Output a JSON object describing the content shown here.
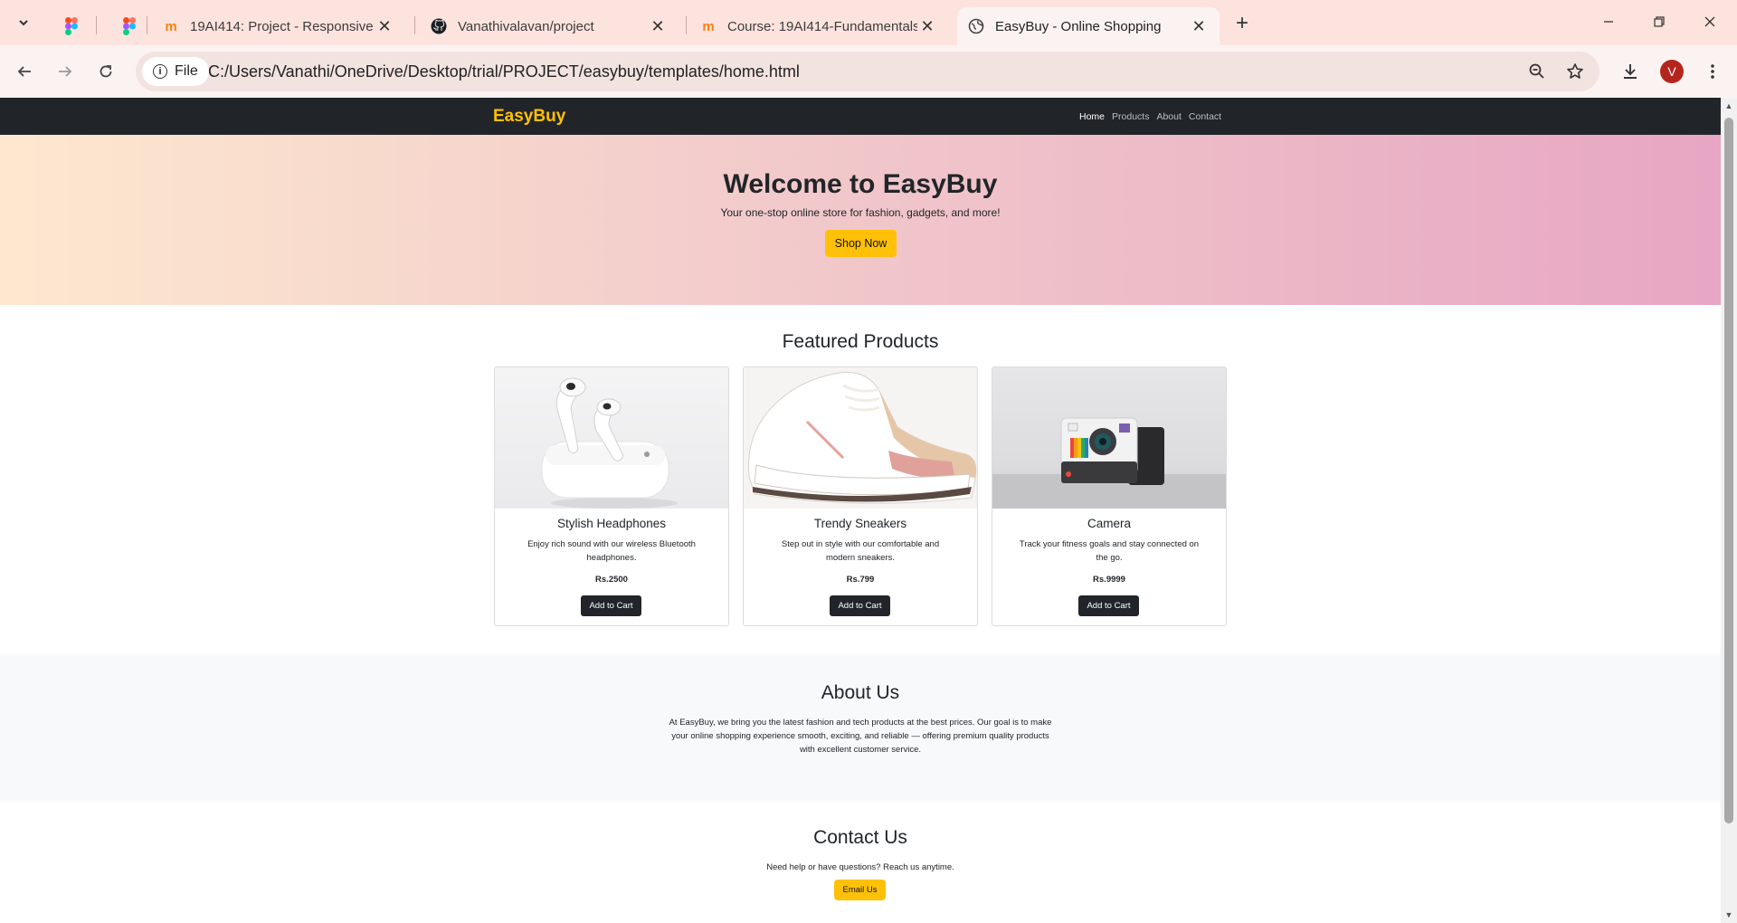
{
  "browser": {
    "tabs": [
      {
        "title": "",
        "favicon": "figma-icon"
      },
      {
        "title": "",
        "favicon": "figma-icon"
      },
      {
        "title": "19AI414: Project - Responsive W",
        "favicon": "moodle-icon"
      },
      {
        "title": "Vanathivalavan/project",
        "favicon": "github-icon"
      },
      {
        "title": "Course: 19AI414-Fundamentals",
        "favicon": "moodle-icon"
      },
      {
        "title": "EasyBuy - Online Shopping",
        "favicon": "globe-icon",
        "active": true
      }
    ],
    "site_chip": "File",
    "url": "C:/Users/Vanathi/OneDrive/Desktop/trial/PROJECT/easybuy/templates/home.html",
    "profile_initial": "V",
    "profile_color": "#b3261e"
  },
  "site": {
    "brand": "EasyBuy",
    "brand_color": "#ffc107",
    "nav": [
      "Home",
      "Products",
      "About",
      "Contact"
    ],
    "nav_active": "Home",
    "hero": {
      "title": "Welcome to EasyBuy",
      "subtitle": "Your one-stop online store for fashion, gadgets, and more!",
      "cta": "Shop Now"
    },
    "featured_title": "Featured Products",
    "products": [
      {
        "name": "Stylish Headphones",
        "desc": "Enjoy rich sound with our wireless Bluetooth headphones.",
        "price": "Rs.2500",
        "button": "Add to Cart"
      },
      {
        "name": "Trendy Sneakers",
        "desc": "Step out in style with our comfortable and modern sneakers.",
        "price": "Rs.799",
        "button": "Add to Cart"
      },
      {
        "name": "Camera",
        "desc": "Track your fitness goals and stay connected on the go.",
        "price": "Rs.9999",
        "button": "Add to Cart"
      }
    ],
    "about": {
      "title": "About Us",
      "text": "At EasyBuy, we bring you the latest fashion and tech products at the best prices. Our goal is to make your online shopping experience smooth, exciting, and reliable — offering premium quality products with excellent customer service."
    },
    "contact": {
      "title": "Contact Us",
      "text": "Need help or have questions? Reach us anytime.",
      "button": "Email Us"
    }
  }
}
